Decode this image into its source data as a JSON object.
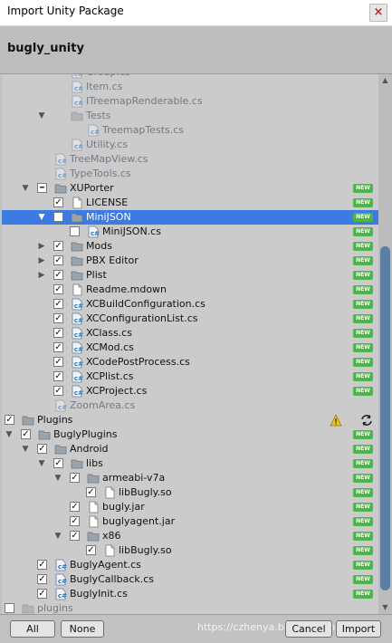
{
  "window": {
    "title": "Import Unity Package",
    "close_icon": "×"
  },
  "package": {
    "name": "bugly_unity"
  },
  "badge_text": "NEW",
  "rows": [
    {
      "label": "Group.cs",
      "type": "script",
      "indent": 76,
      "check": null,
      "expand": null,
      "dim": true,
      "badge": false
    },
    {
      "label": "Item.cs",
      "type": "script",
      "indent": 76,
      "check": null,
      "expand": null,
      "dim": true,
      "badge": false
    },
    {
      "label": "ITreemapRenderable.cs",
      "type": "script",
      "indent": 76,
      "check": null,
      "expand": null,
      "dim": true,
      "badge": false
    },
    {
      "label": "Tests",
      "type": "folder",
      "indent": 76,
      "check": null,
      "expand": "open",
      "dim": true,
      "badge": false
    },
    {
      "label": "TreemapTests.cs",
      "type": "script",
      "indent": 94,
      "check": null,
      "expand": null,
      "dim": true,
      "badge": false
    },
    {
      "label": "Utility.cs",
      "type": "script",
      "indent": 76,
      "check": null,
      "expand": null,
      "dim": true,
      "badge": false
    },
    {
      "label": "TreeMapView.cs",
      "type": "script",
      "indent": 58,
      "check": null,
      "expand": null,
      "dim": true,
      "badge": false
    },
    {
      "label": "TypeTools.cs",
      "type": "script",
      "indent": 58,
      "check": null,
      "expand": null,
      "dim": true,
      "badge": false
    },
    {
      "label": "XUPorter",
      "type": "folder",
      "indent": 58,
      "check": "mixed",
      "expand": "open",
      "dim": false,
      "badge": true
    },
    {
      "label": "LICENSE",
      "type": "file",
      "indent": 76,
      "check": "checked",
      "expand": null,
      "dim": false,
      "badge": true
    },
    {
      "label": "MiniJSON",
      "type": "folder",
      "indent": 76,
      "check": "unchecked",
      "expand": "open",
      "dim": false,
      "badge": true,
      "selected": true
    },
    {
      "label": "MiniJSON.cs",
      "type": "script",
      "indent": 94,
      "check": "unchecked",
      "expand": null,
      "dim": false,
      "badge": true
    },
    {
      "label": "Mods",
      "type": "folder",
      "indent": 76,
      "check": "checked",
      "expand": "closed",
      "dim": false,
      "badge": true
    },
    {
      "label": "PBX Editor",
      "type": "folder",
      "indent": 76,
      "check": "checked",
      "expand": "closed",
      "dim": false,
      "badge": true
    },
    {
      "label": "Plist",
      "type": "folder",
      "indent": 76,
      "check": "checked",
      "expand": "closed",
      "dim": false,
      "badge": true
    },
    {
      "label": "Readme.mdown",
      "type": "file",
      "indent": 76,
      "check": "checked",
      "expand": null,
      "dim": false,
      "badge": true
    },
    {
      "label": "XCBuildConfiguration.cs",
      "type": "script",
      "indent": 76,
      "check": "checked",
      "expand": null,
      "dim": false,
      "badge": true
    },
    {
      "label": "XCConfigurationList.cs",
      "type": "script",
      "indent": 76,
      "check": "checked",
      "expand": null,
      "dim": false,
      "badge": true
    },
    {
      "label": "XClass.cs",
      "type": "script",
      "indent": 76,
      "check": "checked",
      "expand": null,
      "dim": false,
      "badge": true
    },
    {
      "label": "XCMod.cs",
      "type": "script",
      "indent": 76,
      "check": "checked",
      "expand": null,
      "dim": false,
      "badge": true
    },
    {
      "label": "XCodePostProcess.cs",
      "type": "script",
      "indent": 76,
      "check": "checked",
      "expand": null,
      "dim": false,
      "badge": true
    },
    {
      "label": "XCPlist.cs",
      "type": "script",
      "indent": 76,
      "check": "checked",
      "expand": null,
      "dim": false,
      "badge": true
    },
    {
      "label": "XCProject.cs",
      "type": "script",
      "indent": 76,
      "check": "checked",
      "expand": null,
      "dim": false,
      "badge": true
    },
    {
      "label": "ZoomArea.cs",
      "type": "script",
      "indent": 58,
      "check": null,
      "expand": null,
      "dim": true,
      "badge": false
    },
    {
      "label": "Plugins",
      "type": "folder",
      "indent": 22,
      "check": "checked",
      "expand": "open",
      "dim": false,
      "badge": false,
      "warn": true,
      "refresh": true
    },
    {
      "label": "BuglyPlugins",
      "type": "folder",
      "indent": 40,
      "check": "checked",
      "expand": "open",
      "dim": false,
      "badge": true
    },
    {
      "label": "Android",
      "type": "folder",
      "indent": 58,
      "check": "checked",
      "expand": "open",
      "dim": false,
      "badge": true
    },
    {
      "label": "libs",
      "type": "folder",
      "indent": 76,
      "check": "checked",
      "expand": "open",
      "dim": false,
      "badge": true
    },
    {
      "label": "armeabi-v7a",
      "type": "folder",
      "indent": 94,
      "check": "checked",
      "expand": "open",
      "dim": false,
      "badge": true
    },
    {
      "label": "libBugly.so",
      "type": "file",
      "indent": 112,
      "check": "checked",
      "expand": null,
      "dim": false,
      "badge": true
    },
    {
      "label": "bugly.jar",
      "type": "file",
      "indent": 94,
      "check": "checked",
      "expand": null,
      "dim": false,
      "badge": true
    },
    {
      "label": "buglyagent.jar",
      "type": "file",
      "indent": 94,
      "check": "checked",
      "expand": null,
      "dim": false,
      "badge": true
    },
    {
      "label": "x86",
      "type": "folder",
      "indent": 94,
      "check": "checked",
      "expand": "open",
      "dim": false,
      "badge": true
    },
    {
      "label": "libBugly.so",
      "type": "file",
      "indent": 112,
      "check": "checked",
      "expand": null,
      "dim": false,
      "badge": true
    },
    {
      "label": "BuglyAgent.cs",
      "type": "script",
      "indent": 58,
      "check": "checked",
      "expand": null,
      "dim": false,
      "badge": true
    },
    {
      "label": "BuglyCallback.cs",
      "type": "script",
      "indent": 58,
      "check": "checked",
      "expand": null,
      "dim": false,
      "badge": true
    },
    {
      "label": "BuglyInit.cs",
      "type": "script",
      "indent": 58,
      "check": "checked",
      "expand": null,
      "dim": false,
      "badge": true
    },
    {
      "label": "plugins",
      "type": "folder",
      "indent": 22,
      "check": "unchecked",
      "expand": "closed",
      "dim": true,
      "badge": false
    }
  ],
  "footer": {
    "all_label": "All",
    "none_label": "None",
    "cancel_label": "Cancel",
    "import_label": "Import",
    "watermark": "https://czhenya.blog.csdn.net"
  },
  "colors": {
    "selection": "#3d7be3",
    "badge": "#4bb744",
    "folder": "#8f9aa4",
    "script_icon": "#3a82c4"
  }
}
